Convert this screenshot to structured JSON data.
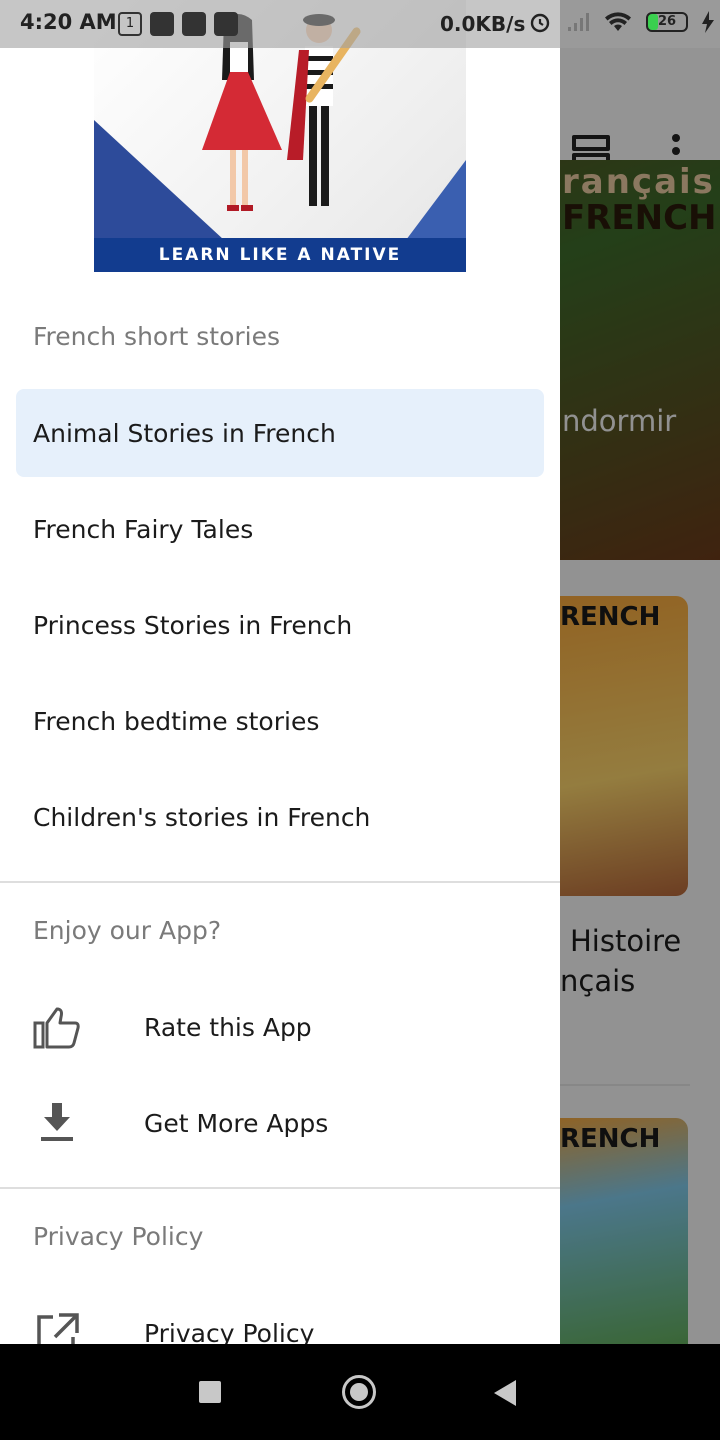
{
  "status_bar": {
    "time": "4:20 AM",
    "network_speed": "0.0KB/s",
    "battery_level": "26",
    "calendar_day": "1"
  },
  "background_app": {
    "banner_text_top": "rançais",
    "banner_text_bottom": "FRENCH",
    "banner_subtitle": "ndormir",
    "card_1_header": "RENCH",
    "card_1_title_line1": "Histoire",
    "card_1_title_line2": "nçais",
    "card_2_header": "RENCH"
  },
  "drawer": {
    "header_banner": "LEARN LIKE A NATIVE",
    "section_stories": "French short stories",
    "stories": [
      {
        "label": "Animal Stories in French",
        "active": true
      },
      {
        "label": "French Fairy Tales",
        "active": false
      },
      {
        "label": "Princess Stories in French",
        "active": false
      },
      {
        "label": "French bedtime stories",
        "active": false
      },
      {
        "label": "Children's stories in French",
        "active": false
      }
    ],
    "section_enjoy": "Enjoy our App?",
    "rate_label": "Rate this App",
    "more_apps_label": "Get More Apps",
    "section_privacy": "Privacy Policy",
    "privacy_label": "Privacy Policy"
  },
  "colors": {
    "active_item_bg": "#e6f0fb",
    "header_banner_bg": "#123c8f",
    "section_title": "#7a7a7a"
  },
  "icons": {
    "rate": "thumbs-up-icon",
    "more_apps": "download-icon",
    "privacy": "external-link-icon"
  }
}
